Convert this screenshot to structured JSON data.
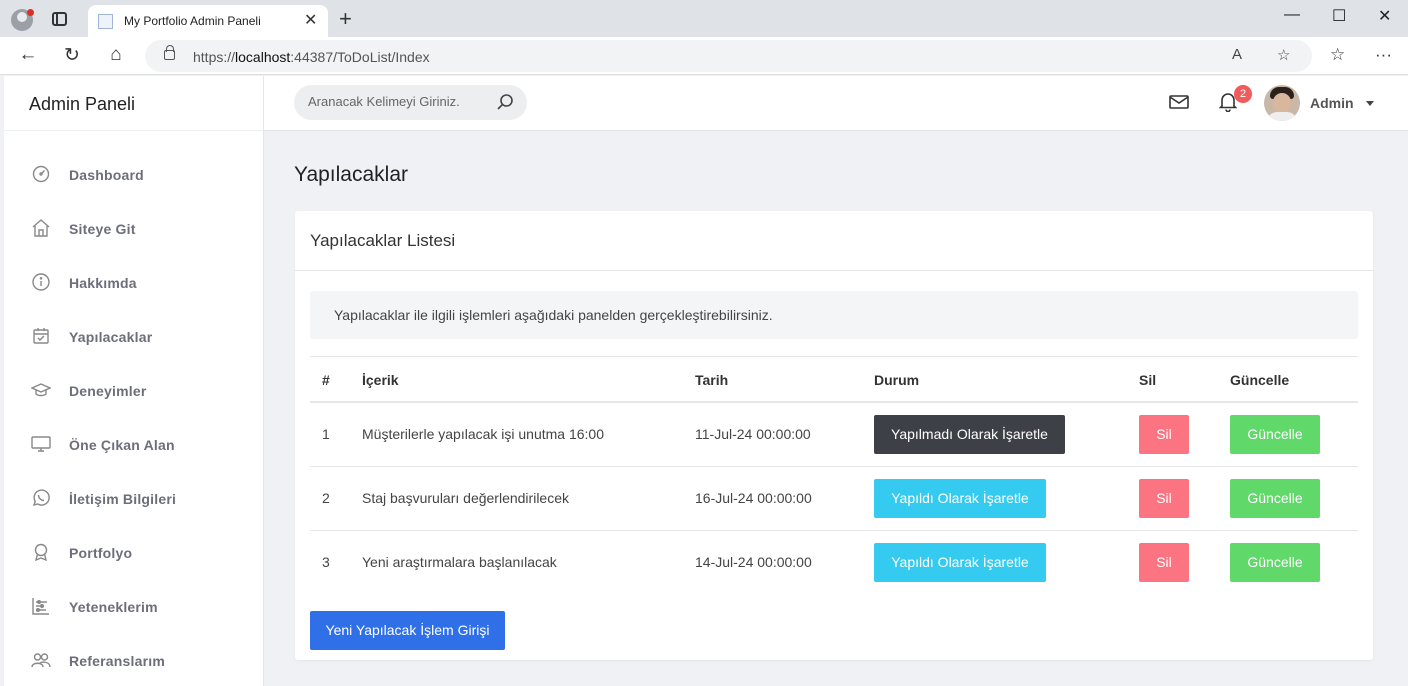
{
  "browser": {
    "tab_title": "My Portfolio Admin Paneli",
    "url_prefix": "https://",
    "url_host": "localhost",
    "url_rest": ":44387/ToDoList/Index"
  },
  "sidebar": {
    "brand": "Admin Paneli",
    "items": [
      {
        "label": "Dashboard",
        "icon": "dashboard-icon"
      },
      {
        "label": "Siteye Git",
        "icon": "home-icon"
      },
      {
        "label": "Hakkımda",
        "icon": "info-icon"
      },
      {
        "label": "Yapılacaklar",
        "icon": "calendar-check-icon"
      },
      {
        "label": "Deneyimler",
        "icon": "graduation-cap-icon"
      },
      {
        "label": "Öne Çıkan Alan",
        "icon": "monitor-icon"
      },
      {
        "label": "İletişim Bilgileri",
        "icon": "whatsapp-icon"
      },
      {
        "label": "Portfolyo",
        "icon": "award-icon"
      },
      {
        "label": "Yeteneklerim",
        "icon": "sliders-icon"
      },
      {
        "label": "Referanslarım",
        "icon": "users-icon"
      }
    ]
  },
  "topbar": {
    "search_placeholder": "Aranacak Kelimeyi Giriniz.",
    "notification_count": "2",
    "user_name": "Admin"
  },
  "page": {
    "title": "Yapılacaklar",
    "card_title": "Yapılacaklar Listesi",
    "info_text": "Yapılacaklar ile ilgili işlemleri aşağıdaki panelden gerçekleştirebilirsiniz.",
    "columns": [
      "#",
      "İçerik",
      "Tarih",
      "Durum",
      "Sil",
      "Güncelle"
    ],
    "rows": [
      {
        "id": "1",
        "content": "Müşterilerle yapılacak işi unutma 16:00",
        "date": "11-Jul-24 00:00:00",
        "status_label": "Yapılmadı Olarak İşaretle",
        "delete_label": "Sil",
        "update_label": "Güncelle"
      },
      {
        "id": "2",
        "content": "Staj başvuruları değerlendirilecek",
        "date": "16-Jul-24 00:00:00",
        "status_label": "Yapıldı Olarak İşaretle",
        "delete_label": "Sil",
        "update_label": "Güncelle"
      },
      {
        "id": "3",
        "content": "Yeni araştırmalara başlanılacak",
        "date": "14-Jul-24 00:00:00",
        "status_label": "Yapıldı Olarak İşaretle",
        "delete_label": "Sil",
        "update_label": "Güncelle"
      }
    ],
    "new_button": "Yeni Yapılacak İşlem Girişi"
  },
  "colors": {
    "primary": "#2f6fe8",
    "info": "#35cbf0",
    "danger": "#fc7381",
    "success": "#61d86a",
    "dark": "#3d4046"
  }
}
